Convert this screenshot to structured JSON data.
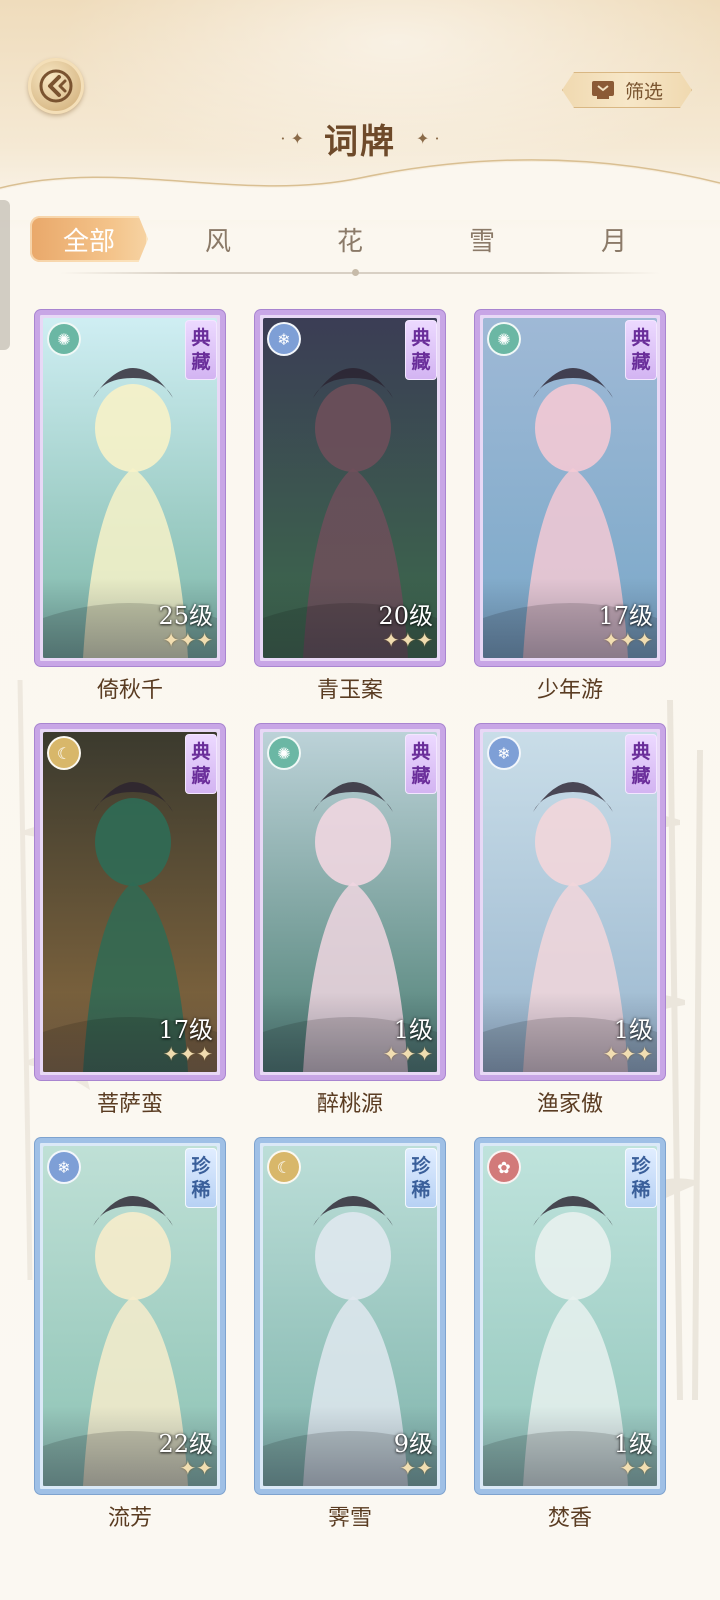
{
  "header": {
    "title": "词牌",
    "filter_label": "筛选"
  },
  "tabs": [
    {
      "label": "全部",
      "active": true
    },
    {
      "label": "风",
      "active": false
    },
    {
      "label": "花",
      "active": false
    },
    {
      "label": "雪",
      "active": false
    },
    {
      "label": "月",
      "active": false
    }
  ],
  "cards": [
    {
      "name": "倚秋千",
      "level": "25级",
      "rarity": "典藏",
      "element": "wind",
      "stars": 3
    },
    {
      "name": "青玉案",
      "level": "20级",
      "rarity": "典藏",
      "element": "snow",
      "stars": 3
    },
    {
      "name": "少年游",
      "level": "17级",
      "rarity": "典藏",
      "element": "wind",
      "stars": 3
    },
    {
      "name": "菩萨蛮",
      "level": "17级",
      "rarity": "典藏",
      "element": "moon",
      "stars": 3
    },
    {
      "name": "醉桃源",
      "level": "1级",
      "rarity": "典藏",
      "element": "wind",
      "stars": 3
    },
    {
      "name": "渔家傲",
      "level": "1级",
      "rarity": "典藏",
      "element": "snow",
      "stars": 3
    },
    {
      "name": "流芳",
      "level": "22级",
      "rarity": "珍稀",
      "element": "snow",
      "stars": 2
    },
    {
      "name": "霁雪",
      "level": "9级",
      "rarity": "珍稀",
      "element": "moon",
      "stars": 2
    },
    {
      "name": "焚香",
      "level": "1级",
      "rarity": "珍稀",
      "element": "flower",
      "stars": 2
    }
  ],
  "colors": {
    "accent": "#f0b47a",
    "title": "#6e4a2a",
    "rare_purple": "#c8a6e6",
    "rare_blue": "#9fc0e6"
  }
}
